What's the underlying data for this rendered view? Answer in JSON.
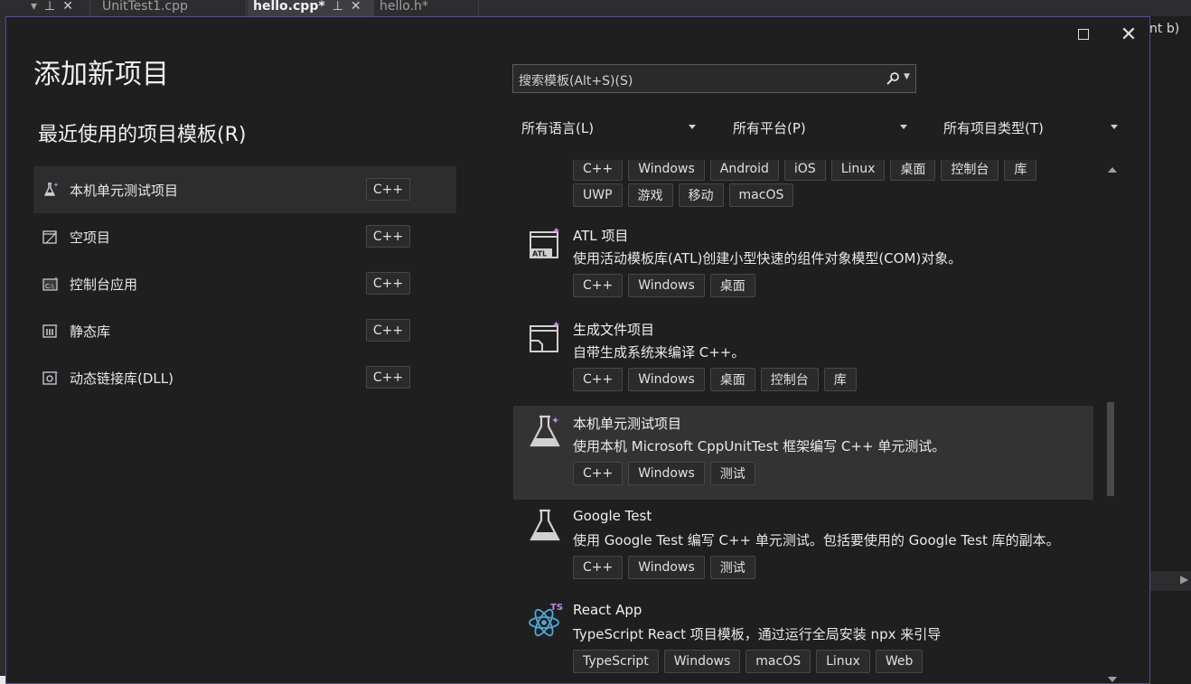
{
  "ide": {
    "tabs": [
      {
        "label": "UnitTest1.cpp"
      },
      {
        "label": "hello.cpp*",
        "active": true
      },
      {
        "label": "hello.h*"
      }
    ],
    "right_text": "nt b)"
  },
  "dialog": {
    "title": "添加新项目",
    "recent_title": "最近使用的项目模板(R)",
    "recent": [
      {
        "label": "本机单元测试项目",
        "badge": "C++",
        "icon": "flask-icon",
        "selected": true
      },
      {
        "label": "空项目",
        "badge": "C++",
        "icon": "empty-project-icon"
      },
      {
        "label": "控制台应用",
        "badge": "C++",
        "icon": "console-icon"
      },
      {
        "label": "静态库",
        "badge": "C++",
        "icon": "static-lib-icon"
      },
      {
        "label": "动态链接库(DLL)",
        "badge": "C++",
        "icon": "dll-icon"
      }
    ],
    "search_placeholder": "搜索模板(Alt+S)(S)",
    "filters": {
      "language": "所有语言(L)",
      "platform": "所有平台(P)",
      "project_type": "所有项目类型(T)"
    },
    "templates_top_tags_row1": [
      "C++",
      "Windows",
      "Android",
      "iOS",
      "Linux",
      "桌面",
      "控制台",
      "库"
    ],
    "templates_top_tags_row2": [
      "UWP",
      "游戏",
      "移动",
      "macOS"
    ],
    "templates": [
      {
        "name": "ATL 项目",
        "desc": "使用活动模板库(ATL)创建小型快速的组件对象模型(COM)对象。",
        "tags": [
          "C++",
          "Windows",
          "桌面"
        ],
        "icon": "atl-icon"
      },
      {
        "name": "生成文件项目",
        "desc": "自带生成系统来编译 C++。",
        "tags": [
          "C++",
          "Windows",
          "桌面",
          "控制台",
          "库"
        ],
        "icon": "makefile-icon"
      },
      {
        "name": "本机单元测试项目",
        "desc": "使用本机 Microsoft CppUnitTest 框架编写 C++ 单元测试。",
        "tags": [
          "C++",
          "Windows",
          "测试"
        ],
        "icon": "flask-icon",
        "selected": true
      },
      {
        "name": "Google Test",
        "desc": "使用 Google Test 编写 C++ 单元测试。包括要使用的 Google Test 库的副本。",
        "tags": [
          "C++",
          "Windows",
          "测试"
        ],
        "icon": "flask-icon"
      },
      {
        "name": "React App",
        "desc": "TypeScript React 项目模板，通过运行全局安装 npx 来引导",
        "tags": [
          "TypeScript",
          "Windows",
          "macOS",
          "Linux",
          "Web"
        ],
        "icon": "react-ts-icon"
      }
    ]
  }
}
